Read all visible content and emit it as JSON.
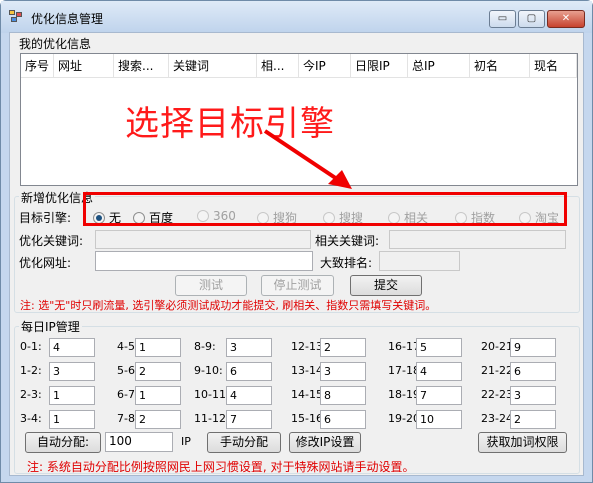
{
  "window": {
    "title": "优化信息管理",
    "min": "▭",
    "max": "▢",
    "close": "✕"
  },
  "list": {
    "group_label": "我的优化信息",
    "columns": [
      "序号",
      "网址",
      "搜索...",
      "关键词",
      "相...",
      "今IP",
      "日限IP",
      "总IP",
      "初名",
      "现名"
    ]
  },
  "add": {
    "group_label": "新增优化信息",
    "engine_label": "目标引擎:",
    "engines": [
      {
        "label": "无",
        "checked": true,
        "enabled": true
      },
      {
        "label": "百度",
        "checked": false,
        "enabled": true
      },
      {
        "label": "360",
        "checked": false,
        "enabled": false
      },
      {
        "label": "搜狗",
        "checked": false,
        "enabled": false
      },
      {
        "label": "搜搜",
        "checked": false,
        "enabled": false
      },
      {
        "label": "相关",
        "checked": false,
        "enabled": false
      },
      {
        "label": "指数",
        "checked": false,
        "enabled": false
      },
      {
        "label": "淘宝",
        "checked": false,
        "enabled": false
      }
    ],
    "keyword_label": "优化关键词:",
    "related_label": "相关关键词:",
    "url_label": "优化网址:",
    "rank_label": "大致排名:",
    "test_button": "测试",
    "stop_button": "停止测试",
    "submit_button": "提交",
    "note": "注: 选\"无\"时只刷流量, 选引擎必须测试成功才能提交, 刷相关、指数只需填写关键词。"
  },
  "daily": {
    "group_label": "每日IP管理",
    "hours": [
      {
        "label": "0-1:",
        "value": "4"
      },
      {
        "label": "4-5:",
        "value": "1"
      },
      {
        "label": "8-9:",
        "value": "3"
      },
      {
        "label": "12-13:",
        "value": "2"
      },
      {
        "label": "16-17:",
        "value": "5"
      },
      {
        "label": "20-21:",
        "value": "9"
      },
      {
        "label": "1-2:",
        "value": "3"
      },
      {
        "label": "5-6:",
        "value": "2"
      },
      {
        "label": "9-10:",
        "value": "6"
      },
      {
        "label": "13-14:",
        "value": "3"
      },
      {
        "label": "17-18:",
        "value": "4"
      },
      {
        "label": "21-22:",
        "value": "6"
      },
      {
        "label": "2-3:",
        "value": "1"
      },
      {
        "label": "6-7:",
        "value": "1"
      },
      {
        "label": "10-11:",
        "value": "4"
      },
      {
        "label": "14-15:",
        "value": "8"
      },
      {
        "label": "18-19:",
        "value": "7"
      },
      {
        "label": "22-23:",
        "value": "3"
      },
      {
        "label": "3-4:",
        "value": "1"
      },
      {
        "label": "7-8:",
        "value": "2"
      },
      {
        "label": "11-12:",
        "value": "7"
      },
      {
        "label": "15-16:",
        "value": "6"
      },
      {
        "label": "19-20:",
        "value": "10"
      },
      {
        "label": "23-24:",
        "value": "2"
      }
    ],
    "auto_button": "自动分配:",
    "total_value": "100",
    "ip_unit": "IP",
    "manual_button": "手动分配",
    "modify_button": "修改IP设置",
    "perm_button": "获取加词权限",
    "note": "注: 系统自动分配比例按照网民上网习惯设置, 对于特殊网站请手动设置。"
  },
  "annotation": {
    "text": "选择目标引擎",
    "color": "#ff1a1a"
  }
}
